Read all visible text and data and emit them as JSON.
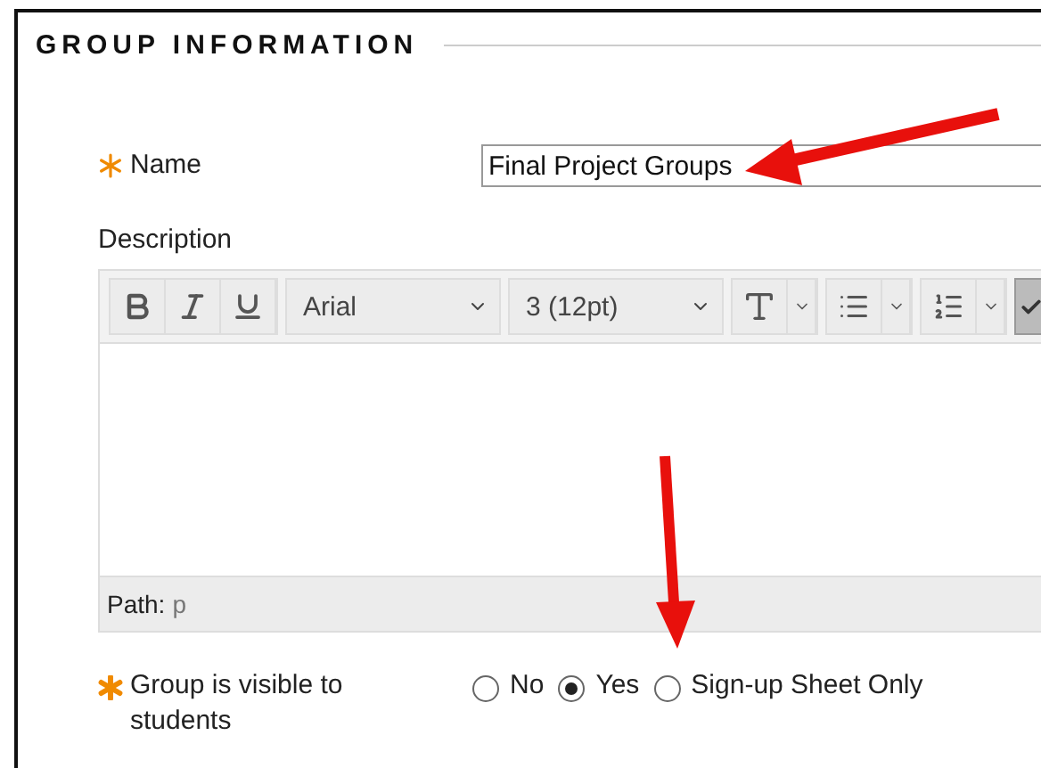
{
  "section": {
    "title": "GROUP INFORMATION"
  },
  "name_field": {
    "label": "Name",
    "required": true,
    "value": "Final Project Groups"
  },
  "description": {
    "label": "Description",
    "toolbar": {
      "font": "Arial",
      "size": "3 (12pt)"
    },
    "path_label": "Path:",
    "path_value": "p"
  },
  "visibility": {
    "label": "Group is visible to students",
    "required": true,
    "options": [
      {
        "label": "No",
        "selected": false
      },
      {
        "label": "Yes",
        "selected": true
      },
      {
        "label": "Sign-up Sheet Only",
        "selected": false
      }
    ]
  }
}
